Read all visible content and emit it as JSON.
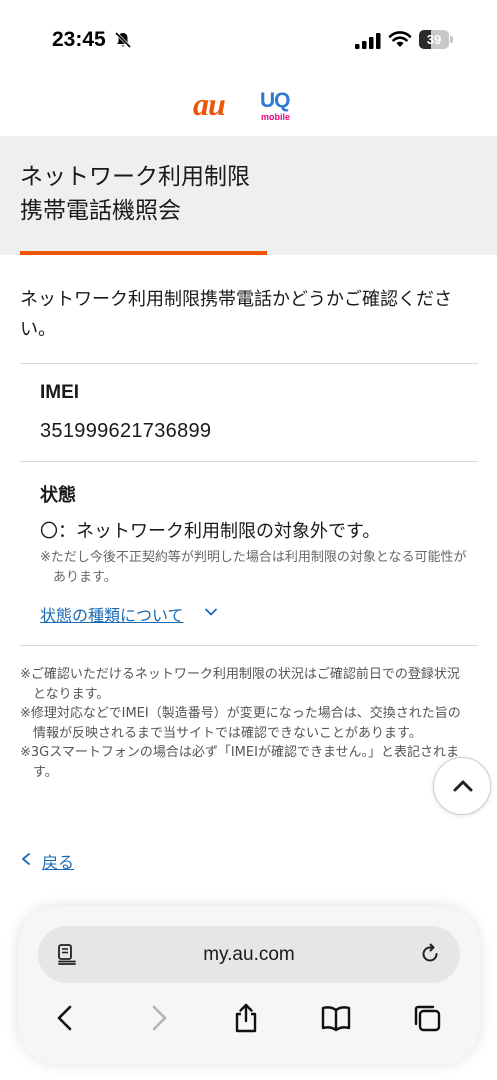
{
  "status_bar": {
    "time": "23:45",
    "battery": 39,
    "battery_text": "39"
  },
  "brand": {
    "au": "au",
    "uq": "UQ",
    "uq_sub": "mobile"
  },
  "page": {
    "title_line1": "ネットワーク利用制限",
    "title_line2": "携帯電話機照会",
    "accent_color": "#eb5505"
  },
  "intro": "ネットワーク利用制限携帯電話かどうかご確認ください。",
  "imei": {
    "label": "IMEI",
    "value": "351999621736899"
  },
  "status": {
    "label": "状態",
    "result": "〇：ネットワーク利用制限の対象外です。",
    "note": "※ただし今後不正契約等が判明した場合は利用制限の対象となる可能性があります。",
    "link": "状態の種類について"
  },
  "notes": [
    "※ご確認いただけるネットワーク利用制限の状況はご確認前日での登録状況となります。",
    "※修理対応などでIMEI（製造番号）が変更になった場合は、交換された旨の情報が反映されるまで当サイトでは確認できないことがあります。",
    "※3Gスマートフォンの場合は必ず「IMEIが確認できません。」と表記されます。"
  ],
  "back_link": "戻る",
  "browser": {
    "url": "my.au.com"
  },
  "icons": {
    "bell": "bell-slash-icon",
    "signal": "cellular-signal-icon",
    "wifi": "wifi-icon",
    "scroll_top": "chevron-up-icon",
    "reader": "reader-mode-icon",
    "reload": "reload-icon",
    "back": "chevron-left-icon",
    "forward": "chevron-right-icon",
    "share": "share-icon",
    "bookmarks": "book-icon",
    "tabs": "tabs-icon"
  }
}
